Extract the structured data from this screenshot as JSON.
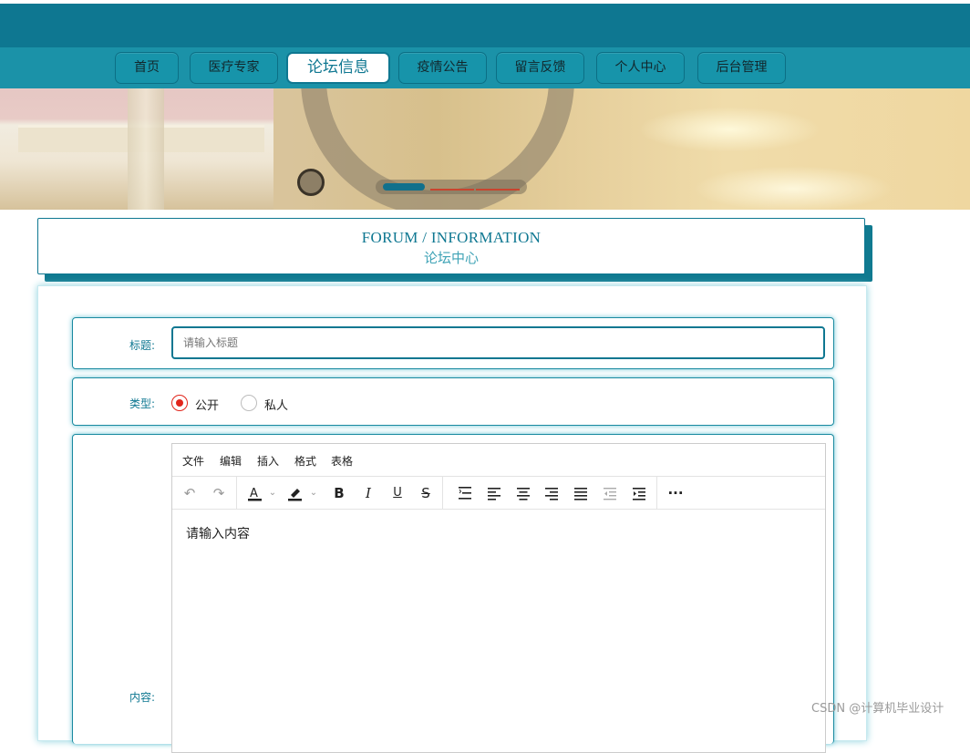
{
  "nav": {
    "items": [
      {
        "label": "首页"
      },
      {
        "label": "医疗专家"
      },
      {
        "label": "论坛信息"
      },
      {
        "label": "疫情公告"
      },
      {
        "label": "留言反馈"
      },
      {
        "label": "个人中心"
      },
      {
        "label": "后台管理"
      }
    ],
    "active": "论坛信息"
  },
  "banner": {
    "slides_total": 3,
    "active_slide": 1
  },
  "section": {
    "title_en": "FORUM / INFORMATION",
    "title_cn": "论坛中心"
  },
  "form": {
    "title_label": "标题:",
    "title_placeholder": "请输入标题",
    "type_label": "类型:",
    "type_options": [
      "公开",
      "私人"
    ],
    "type_selected": "公开",
    "content_label": "内容:"
  },
  "editor": {
    "menus": [
      "文件",
      "编辑",
      "插入",
      "格式",
      "表格"
    ],
    "placeholder": "请输入内容",
    "toolbar_icons": [
      "undo-icon",
      "redo-icon",
      "text-color-icon",
      "highlight-icon",
      "bold-icon",
      "italic-icon",
      "underline-icon",
      "strikethrough-icon",
      "line-height-icon",
      "align-left-icon",
      "align-center-icon",
      "align-right-icon",
      "align-justify-icon",
      "outdent-icon",
      "indent-icon",
      "more-icon"
    ]
  },
  "watermark": "CSDN @计算机毕业设计"
}
